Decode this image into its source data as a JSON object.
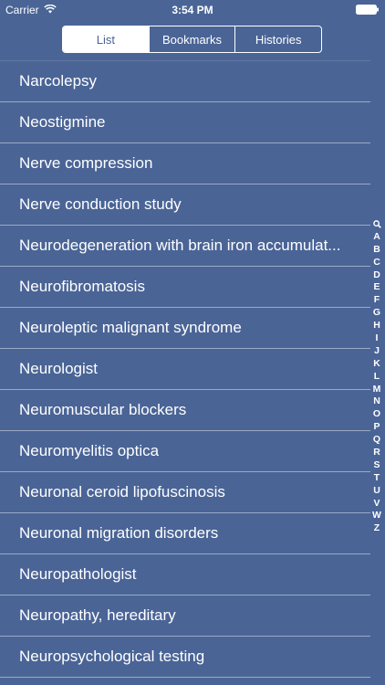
{
  "status_bar": {
    "carrier": "Carrier",
    "time": "3:54 PM",
    "icons": [
      "wifi-icon",
      "battery-icon"
    ]
  },
  "segments": {
    "items": [
      {
        "label": "List",
        "selected": true
      },
      {
        "label": "Bookmarks",
        "selected": false
      },
      {
        "label": "Histories",
        "selected": false
      }
    ]
  },
  "list": {
    "items": [
      "Narcolepsy",
      "Neostigmine",
      "Nerve compression",
      "Nerve conduction study",
      "Neurodegeneration with brain iron accumulat...",
      "Neurofibromatosis",
      "Neuroleptic malignant syndrome",
      "Neurologist",
      "Neuromuscular blockers",
      "Neuromyelitis optica",
      "Neuronal ceroid lipofuscinosis",
      "Neuronal migration disorders",
      "Neuropathologist",
      "Neuropathy, hereditary",
      "Neuropsychological testing"
    ]
  },
  "index": {
    "search_icon": "search-icon",
    "letters": [
      "A",
      "B",
      "C",
      "D",
      "E",
      "F",
      "G",
      "H",
      "I",
      "J",
      "K",
      "L",
      "M",
      "N",
      "O",
      "P",
      "Q",
      "R",
      "S",
      "T",
      "U",
      "V",
      "W",
      "Z"
    ]
  },
  "colors": {
    "background": "#4a6496",
    "text": "#ffffff"
  }
}
